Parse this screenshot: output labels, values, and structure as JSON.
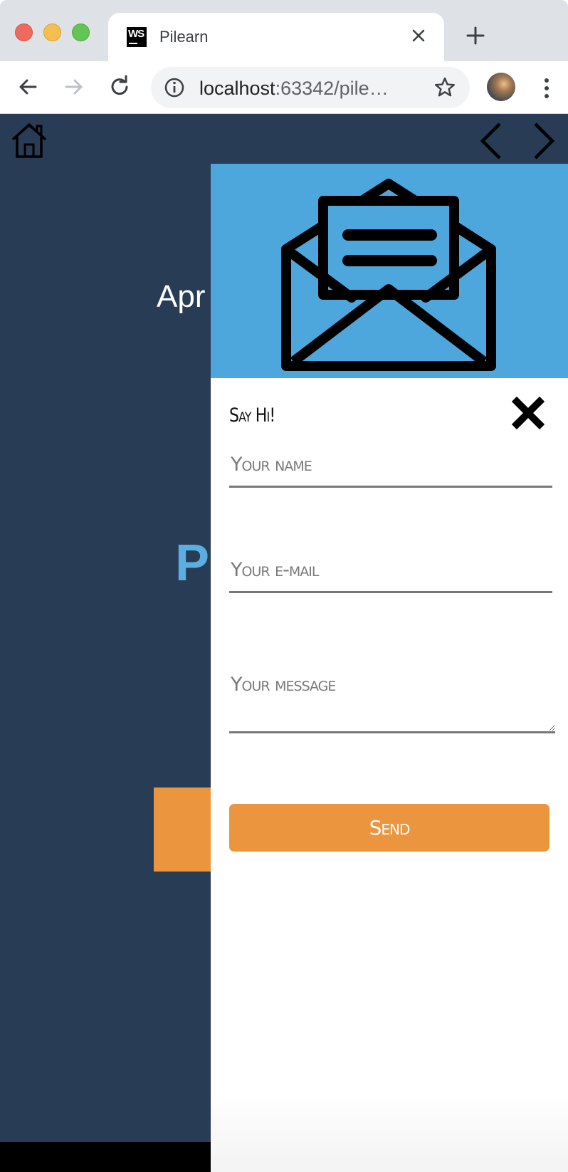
{
  "browser": {
    "tab": {
      "title": "Pilearn",
      "favicon": "WS",
      "close_icon": "close-icon"
    },
    "new_tab_icon": "plus-icon",
    "nav": {
      "back_icon": "arrow-left-icon",
      "forward_icon": "arrow-right-icon",
      "reload_icon": "reload-icon"
    },
    "address": {
      "host": "localhost",
      "rest": ":63342/pile…",
      "info_icon": "info-icon",
      "bookmark_icon": "star-icon"
    },
    "profile_icon": "avatar",
    "menu_icon": "more-vertical-icon"
  },
  "page": {
    "home_icon": "home-icon",
    "nav_icons": [
      "chevron-left-icon",
      "chevron-right-icon"
    ],
    "hero_heading": "Apr",
    "hero_big": "P",
    "colors": {
      "background": "#283c55",
      "accent": "#eb963f",
      "hero_blue": "#5aaee0"
    }
  },
  "contact_panel": {
    "hero_icon": "envelope-open-icon",
    "hero_color": "#4da7dd",
    "title": "Say Hi!",
    "close_icon": "close-x-icon",
    "fields": {
      "name_placeholder": "Your name",
      "email_placeholder": "Your e-mail",
      "message_placeholder": "Your message"
    },
    "send_label": "Send",
    "send_color": "#eb963f"
  }
}
